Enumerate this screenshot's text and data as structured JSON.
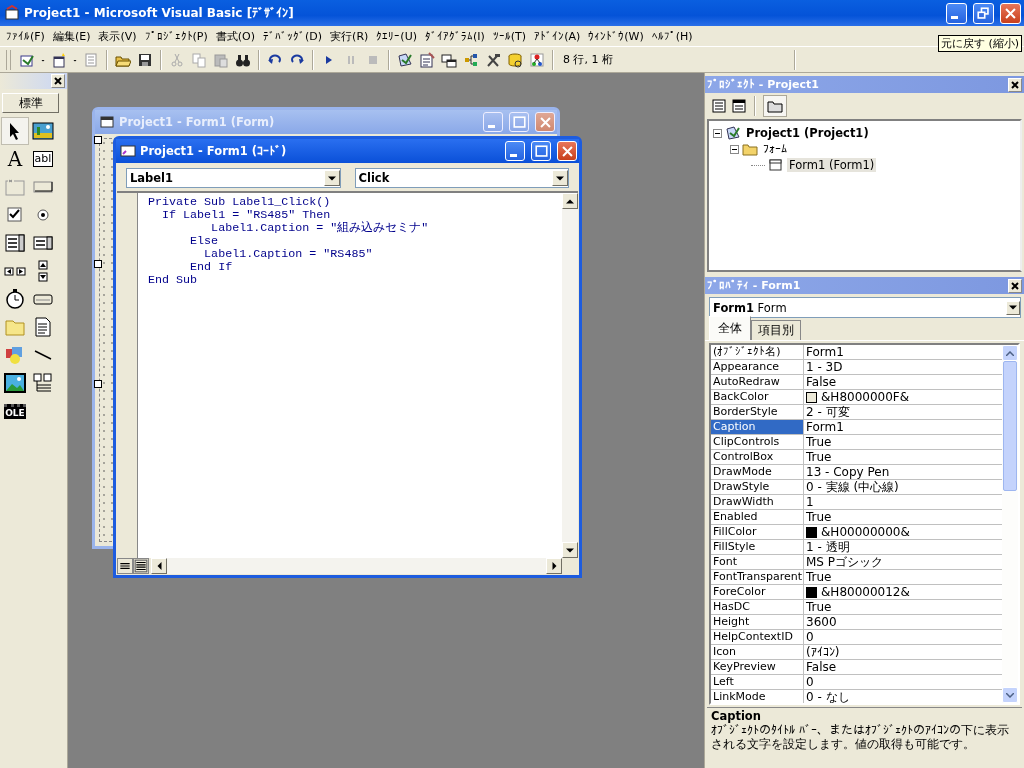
{
  "window": {
    "title": "Project1 - Microsoft Visual Basic [ﾃﾞｻﾞｲﾝ]",
    "tooltip": "元に戻す (縮小)"
  },
  "menu": [
    "ﾌｧｲﾙ(F)",
    "編集(E)",
    "表示(V)",
    "ﾌﾟﾛｼﾞｪｸﾄ(P)",
    "書式(O)",
    "ﾃﾞﾊﾞｯｸﾞ(D)",
    "実行(R)",
    "ｸｴﾘｰ(U)",
    "ﾀﾞｲｱｸﾞﾗﾑ(I)",
    "ﾂｰﾙ(T)",
    "ｱﾄﾞｲﾝ(A)",
    "ｳｨﾝﾄﾞｳ(W)",
    "ﾍﾙﾌﾟ(H)"
  ],
  "toolbar": {
    "position": "8 行, 1 桁"
  },
  "toolbox": {
    "tab": "標準",
    "label_glyph": "A",
    "textbox_glyph": "abl",
    "ole_glyph": "OLE"
  },
  "form_window": {
    "title": "Project1 - Form1 (Form)"
  },
  "code_window": {
    "title": "Project1 - Form1 (ｺｰﾄﾞ)",
    "object": "Label1",
    "procedure": "Click",
    "lines": [
      "Private Sub Label1_Click()",
      "  If Label1 = \"RS485\" Then",
      "         Label1.Caption = \"組み込みセミナ\"",
      "      Else",
      "        Label1.Caption = \"RS485\"",
      "      End If",
      "End Sub"
    ]
  },
  "project": {
    "title": "ﾌﾟﾛｼﾞｪｸﾄ - Project1",
    "toggle_folders_pressed": true,
    "tree": [
      {
        "label": "Project1 (Project1)",
        "kind": "project",
        "expanded": true,
        "selected": false,
        "children": [
          {
            "label": "ﾌｫｰﾑ",
            "kind": "folder",
            "expanded": true,
            "selected": false,
            "children": [
              {
                "label": "Form1 (Form1)",
                "kind": "form",
                "selected": true
              }
            ]
          }
        ]
      }
    ]
  },
  "properties": {
    "title": "ﾌﾟﾛﾊﾟﾃｨ - Form1",
    "object": "**Form1** Form",
    "tabs": [
      {
        "label": "全体",
        "selected": true
      },
      {
        "label": "項目別",
        "selected": false
      }
    ],
    "rows": [
      {
        "name": "(ｵﾌﾞｼﾞｪｸﾄ名)",
        "value": "Form1",
        "selected": false
      },
      {
        "name": "Appearance",
        "value": "1 - 3D",
        "selected": false
      },
      {
        "name": "AutoRedraw",
        "value": "False",
        "selected": false
      },
      {
        "name": "BackColor",
        "value": "&H8000000F&",
        "selected": false,
        "color": "#ece9d8"
      },
      {
        "name": "BorderStyle",
        "value": "2 - 可変",
        "selected": false
      },
      {
        "name": "Caption",
        "value": "Form1",
        "selected": true
      },
      {
        "name": "ClipControls",
        "value": "True",
        "selected": false
      },
      {
        "name": "ControlBox",
        "value": "True",
        "selected": false
      },
      {
        "name": "DrawMode",
        "value": "13 - Copy Pen",
        "selected": false
      },
      {
        "name": "DrawStyle",
        "value": "0 - 実線 (中心線)",
        "selected": false
      },
      {
        "name": "DrawWidth",
        "value": "1",
        "selected": false
      },
      {
        "name": "Enabled",
        "value": "True",
        "selected": false
      },
      {
        "name": "FillColor",
        "value": "&H00000000&",
        "selected": false,
        "color": "#000000"
      },
      {
        "name": "FillStyle",
        "value": "1 - 透明",
        "selected": false
      },
      {
        "name": "Font",
        "value": "MS Pゴシック",
        "selected": false
      },
      {
        "name": "FontTransparent",
        "value": "True",
        "selected": false
      },
      {
        "name": "ForeColor",
        "value": "&H80000012&",
        "selected": false,
        "color": "#000000"
      },
      {
        "name": "HasDC",
        "value": "True",
        "selected": false
      },
      {
        "name": "Height",
        "value": "3600",
        "selected": false
      },
      {
        "name": "HelpContextID",
        "value": "0",
        "selected": false
      },
      {
        "name": "Icon",
        "value": "(ｱｲｺﾝ)",
        "selected": false
      },
      {
        "name": "KeyPreview",
        "value": "False",
        "selected": false
      },
      {
        "name": "Left",
        "value": "0",
        "selected": false
      },
      {
        "name": "LinkMode",
        "value": "0 - なし",
        "selected": false
      }
    ],
    "description_title": "Caption",
    "description": "ｵﾌﾞｼﾞｪｸﾄのﾀｲﾄﾙ ﾊﾞｰ、またはｵﾌﾞｼﾞｪｸﾄのｱｲｺﾝの下に表示される文字を設定します。値の取得も可能です。"
  }
}
